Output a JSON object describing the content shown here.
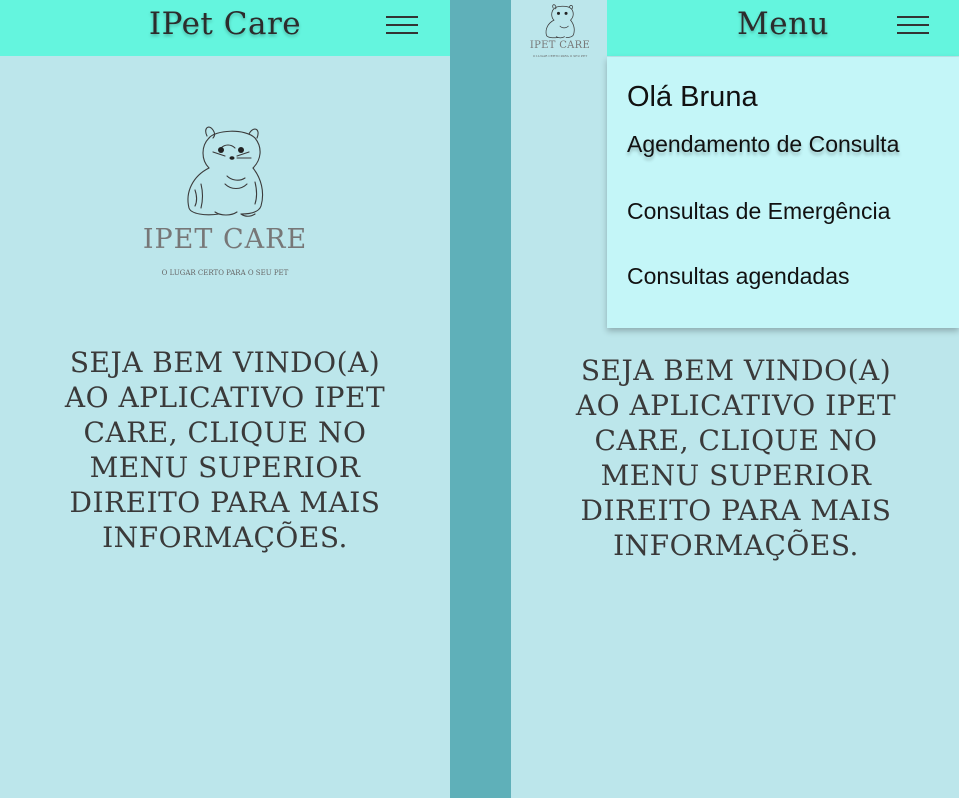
{
  "left_screen": {
    "header": {
      "title": "IPet Care",
      "menu_icon": "hamburger-menu-icon"
    },
    "logo": {
      "icon": "hamster-icon",
      "name": "IPET CARE",
      "tagline": "O LUGAR CERTO PARA O SEU PET"
    },
    "welcome_text": "SEJA BEM VINDO(A) AO APLICATIVO IPET CARE, CLIQUE NO MENU SUPERIOR DIREITO PARA MAIS INFORMAÇÕES."
  },
  "right_screen": {
    "header": {
      "title": "Menu",
      "menu_icon": "hamburger-menu-icon"
    },
    "logo": {
      "icon": "hamster-icon",
      "name": "IPET CARE",
      "tagline": "O LUGAR CERTO PARA O SEU PET"
    },
    "menu": {
      "greeting": "Olá Bruna",
      "items": [
        {
          "label": "Agendamento de Consulta"
        },
        {
          "label": "Consultas de Emergência"
        },
        {
          "label": "Consultas agendadas"
        }
      ]
    },
    "welcome_text": "SEJA BEM VINDO(A) AO APLICATIVO IPET CARE, CLIQUE NO MENU SUPERIOR DIREITO PARA MAIS INFORMAÇÕES."
  },
  "colors": {
    "header_bg": "#64f5de",
    "screen_bg": "#bce6eb",
    "divider_bg": "#5fb0b9",
    "menu_bg": "#c4f6f8"
  }
}
